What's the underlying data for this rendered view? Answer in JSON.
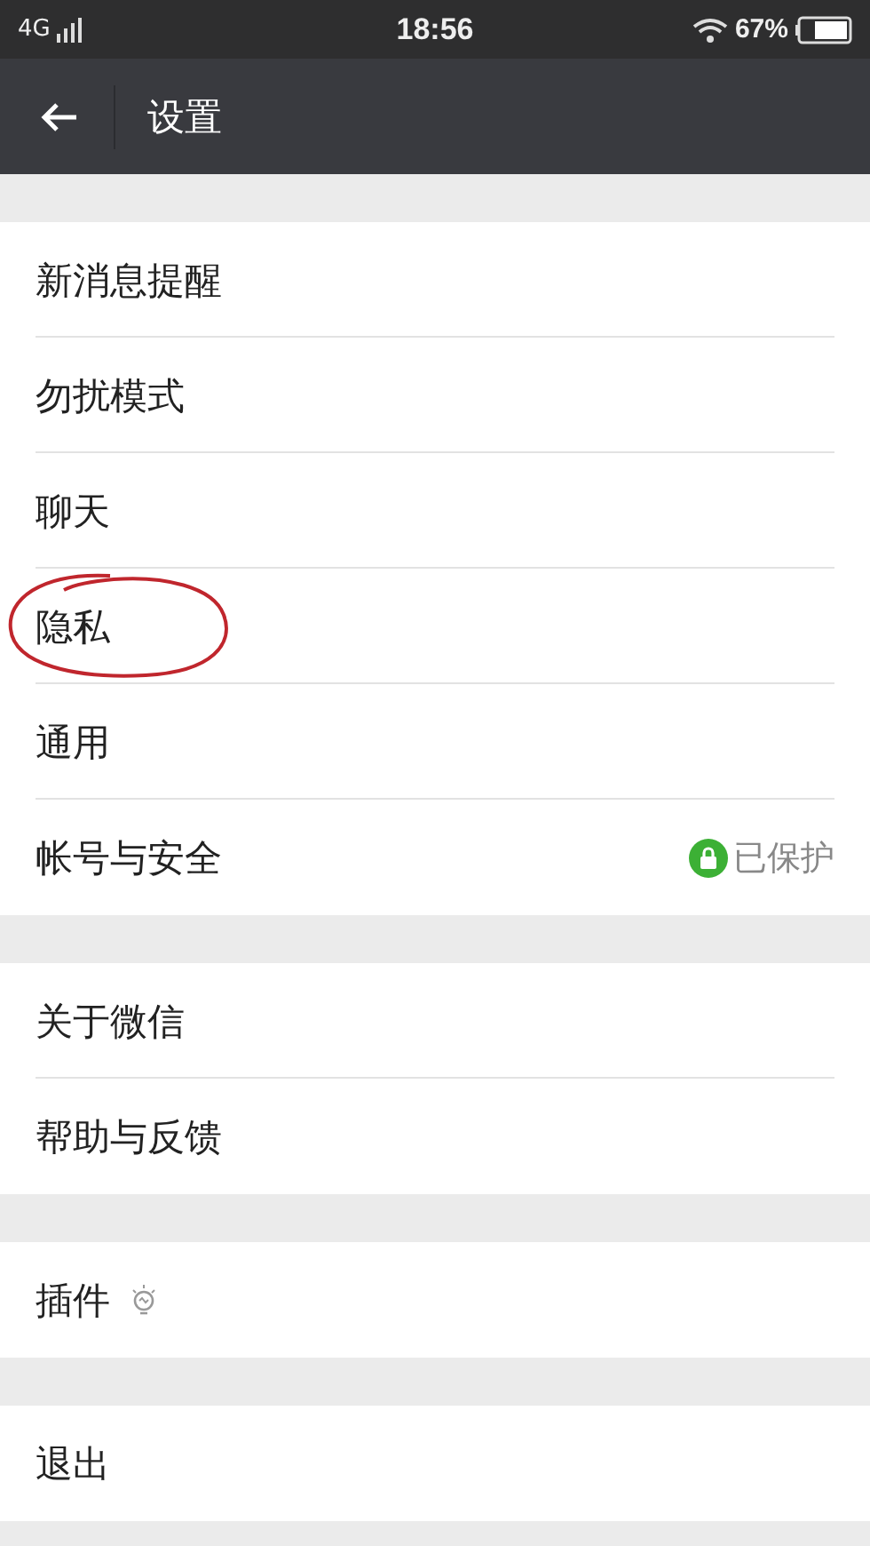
{
  "status_bar": {
    "network": "4G",
    "time": "18:56",
    "battery": "67%"
  },
  "header": {
    "title": "设置"
  },
  "groups": [
    {
      "items": [
        {
          "label": "新消息提醒",
          "circled": false
        },
        {
          "label": "勿扰模式",
          "circled": false
        },
        {
          "label": "聊天",
          "circled": false
        },
        {
          "label": "隐私",
          "circled": true
        },
        {
          "label": "通用",
          "circled": false
        },
        {
          "label": "帐号与安全",
          "circled": false,
          "status": "已保护"
        }
      ]
    },
    {
      "items": [
        {
          "label": "关于微信",
          "circled": false
        },
        {
          "label": "帮助与反馈",
          "circled": false
        }
      ]
    },
    {
      "items": [
        {
          "label": "插件",
          "circled": false,
          "kind": "with-icon"
        }
      ]
    },
    {
      "items": [
        {
          "label": "退出",
          "circled": false
        }
      ]
    }
  ]
}
